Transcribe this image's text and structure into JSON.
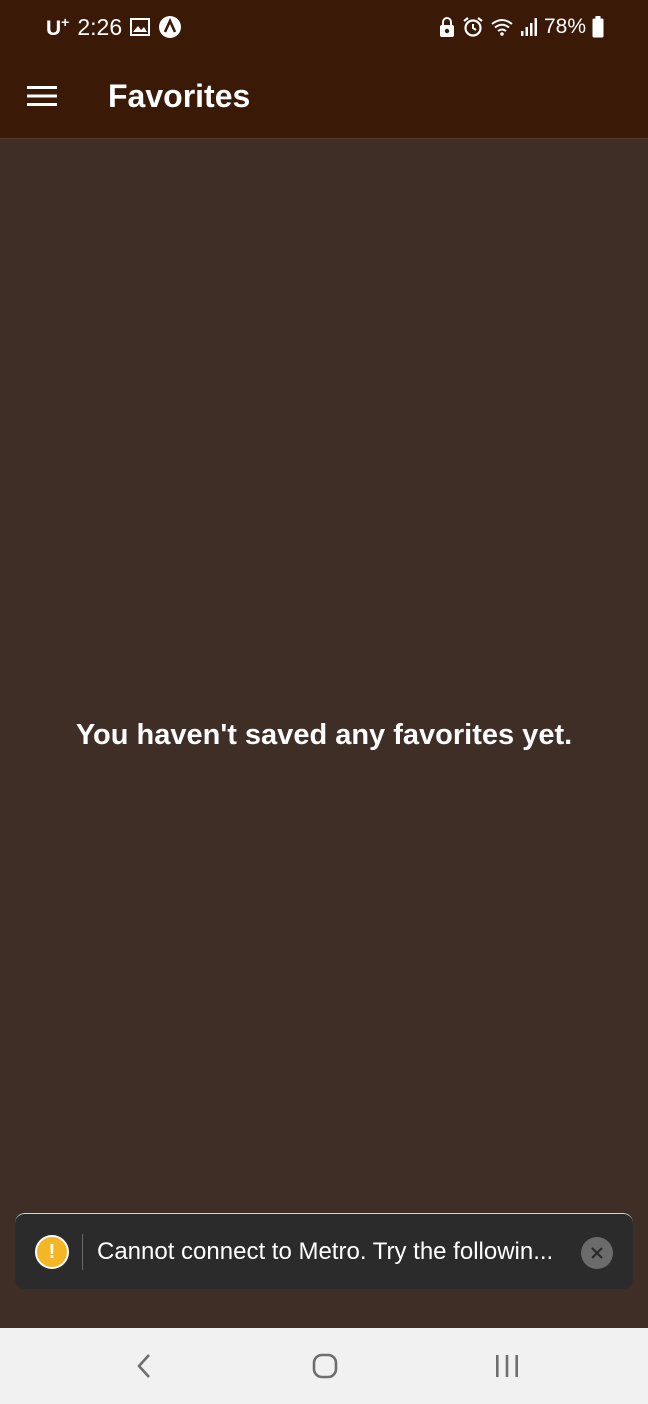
{
  "status_bar": {
    "carrier": "U",
    "carrier_sup": "+",
    "time": "2:26",
    "battery": "78%",
    "icons": [
      "gallery-icon",
      "app-notification-icon",
      "lock-icon",
      "alarm-icon",
      "wifi-icon",
      "signal-icon",
      "battery-icon"
    ]
  },
  "app_bar": {
    "title": "Favorites",
    "menu_icon": "hamburger-menu-icon"
  },
  "main": {
    "empty_message": "You haven't saved any favorites yet."
  },
  "toast": {
    "message": "Cannot connect to Metro.  Try the followin...",
    "icon": "warning-icon",
    "close_icon": "close-icon"
  },
  "nav_bar": {
    "buttons": [
      "back-icon",
      "home-icon",
      "recent-apps-icon"
    ]
  },
  "colors": {
    "app_bar_bg": "#3a1907",
    "content_bg": "#3f2e25",
    "toast_bg": "#2b2b2b",
    "warning": "#f5b625",
    "nav_bar_bg": "#f1f1f1"
  }
}
